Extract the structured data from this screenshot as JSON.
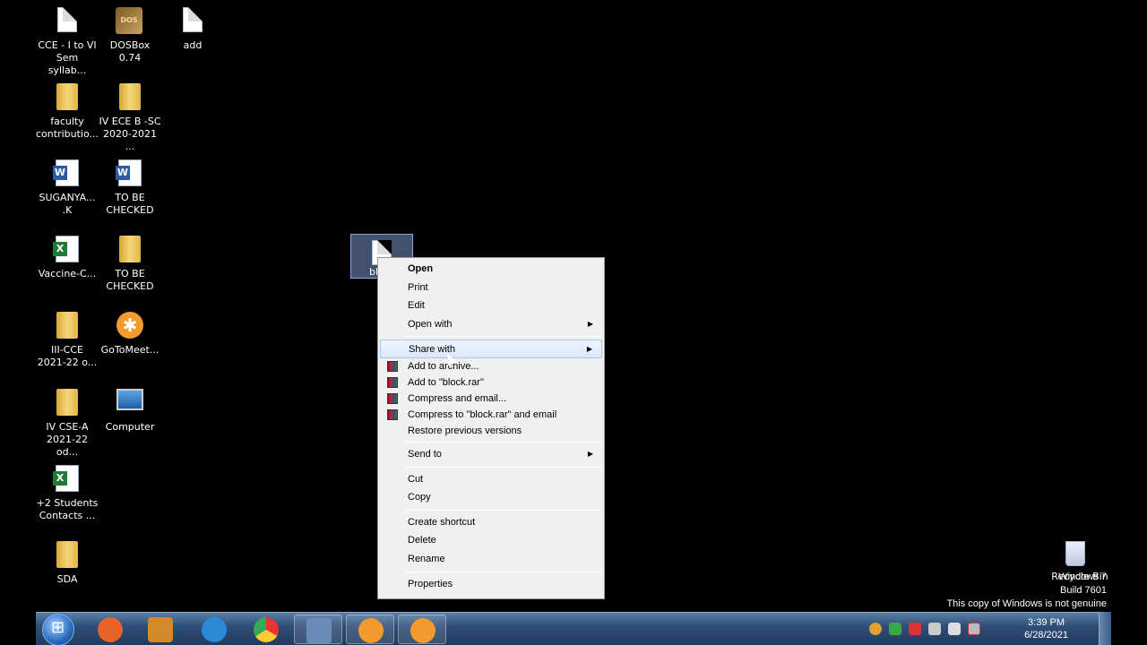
{
  "desktop": {
    "icons": [
      {
        "label": "CCE - I to VI\nSem syllab...",
        "icon": "document-icon"
      },
      {
        "label": "DOSBox 0.74",
        "icon": "dosbox-icon",
        "glyph": "DOS"
      },
      {
        "label": "add",
        "icon": "document-icon"
      },
      {
        "label": "faculty\ncontributio...",
        "icon": "folder-icon"
      },
      {
        "label": "IV ECE B -SC\n2020-2021 ...",
        "icon": "folder-icon"
      },
      {
        "label": "SUGANYA...\n.K",
        "icon": "word-doc-icon"
      },
      {
        "label": "TO BE\nCHECKED",
        "icon": "word-doc-icon"
      },
      {
        "label": "Vaccine-C...",
        "icon": "excel-doc-icon"
      },
      {
        "label": "TO BE\nCHECKED",
        "icon": "folder-icon"
      },
      {
        "label": "III-CCE\n2021-22 o...",
        "icon": "folder-icon"
      },
      {
        "label": "GoToMeet...",
        "icon": "gotomeeting-icon"
      },
      {
        "label": "IV CSE-A\n2021-22 od...",
        "icon": "folder-icon"
      },
      {
        "label": "Computer",
        "icon": "computer-icon"
      },
      {
        "label": "+2 Students\nContacts ...",
        "icon": "excel-doc-icon"
      },
      {
        "label": "SDA",
        "icon": "folder-icon"
      }
    ],
    "selected_file_label": "bl",
    "recycle_bin_label": "Recycle Bin"
  },
  "context_menu": {
    "items": {
      "open": "Open",
      "print": "Print",
      "edit": "Edit",
      "open_with": "Open with",
      "share_with": "Share with",
      "add_to_archive": "Add to archive...",
      "add_to_rar": "Add to \"block.rar\"",
      "compress_email": "Compress and email...",
      "compress_rar_email": "Compress to \"block.rar\" and email",
      "restore": "Restore previous versions",
      "send_to": "Send to",
      "cut": "Cut",
      "copy": "Copy",
      "create_shortcut": "Create shortcut",
      "delete": "Delete",
      "rename": "Rename",
      "properties": "Properties"
    },
    "submenu_arrow": "▶"
  },
  "watermark": {
    "line1": "Windows 7",
    "line2": "Build 7601",
    "line3": "This copy of Windows is not genuine"
  },
  "taskbar": {
    "clock_time": "3:39 PM",
    "clock_date": "6/28/2021",
    "buttons": [
      {
        "icon": "firefox-icon",
        "color": "#e8622a"
      },
      {
        "icon": "media-player-icon",
        "color": "#d48a2a"
      },
      {
        "icon": "internet-explorer-icon",
        "color": "#2a8ad8"
      },
      {
        "icon": "chrome-icon",
        "color": "#3aa845"
      },
      {
        "icon": "network-app-icon",
        "color": "#6a8ab8"
      },
      {
        "icon": "gotomeeting-icon",
        "color": "#f29a2e"
      },
      {
        "icon": "gotomeeting-icon",
        "color": "#f29a2e"
      }
    ]
  },
  "colors": {
    "desktop_bg": "#000000",
    "menu_bg": "#f0f0f0",
    "menu_hover": "#dae7fb",
    "taskbar": "#2f4f78"
  }
}
